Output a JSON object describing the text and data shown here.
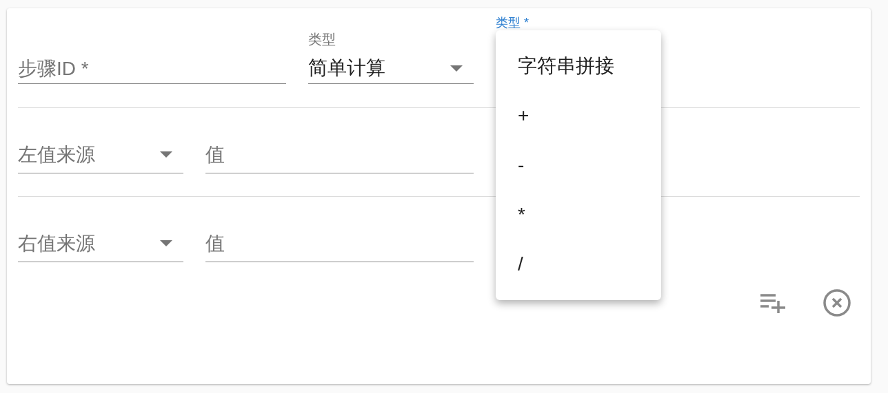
{
  "form": {
    "step_id": {
      "placeholder": "步骤ID *"
    },
    "type_select": {
      "label": "类型",
      "value": "简单计算"
    },
    "operation_select": {
      "label": "类型 *",
      "focused": true
    },
    "operands": [
      {
        "source_placeholder": "左值来源",
        "value_placeholder": "值"
      },
      {
        "source_placeholder": "右值来源",
        "value_placeholder": "值"
      }
    ]
  },
  "menu": {
    "items": [
      "字符串拼接",
      "+",
      "-",
      "*",
      "/"
    ]
  }
}
